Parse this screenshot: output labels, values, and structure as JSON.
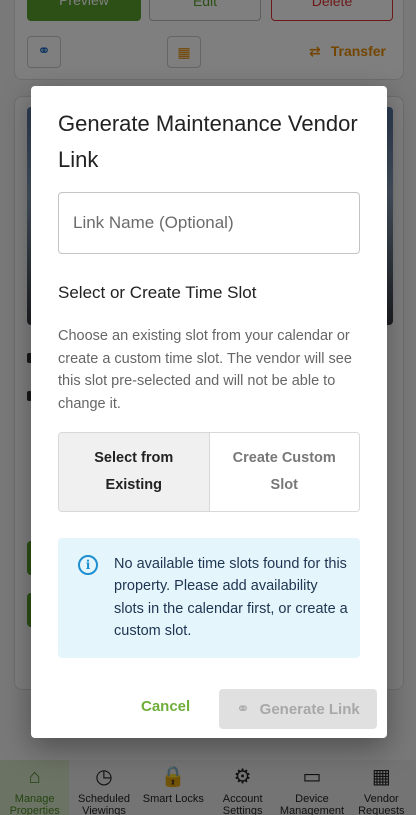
{
  "background": {
    "buttons": {
      "preview": "Preview",
      "edit": "Edit",
      "delete": "Delete",
      "transfer": "Transfer"
    }
  },
  "bottom_nav": [
    {
      "label": "Manage Properties",
      "icon": "home-icon",
      "glyph": "⌂",
      "active": true
    },
    {
      "label": "Scheduled Viewings",
      "icon": "clock-icon",
      "glyph": "◷",
      "active": false
    },
    {
      "label": "Smart Locks",
      "icon": "lock-icon",
      "glyph": "🔒",
      "active": false
    },
    {
      "label": "Account Settings",
      "icon": "gear-icon",
      "glyph": "⚙",
      "active": false
    },
    {
      "label": "Device Management",
      "icon": "devices-icon",
      "glyph": "▭",
      "active": false
    },
    {
      "label": "Vendor Requests",
      "icon": "building-icon",
      "glyph": "▦",
      "active": false
    }
  ],
  "dialog": {
    "title": "Generate Maintenance Vendor Link",
    "link_name_placeholder": "Link Name (Optional)",
    "section_title": "Select or Create Time Slot",
    "description": "Choose an existing slot from your calendar or create a custom time slot. The vendor will see this slot pre-selected and will not be able to change it.",
    "toggle": {
      "option_existing": "Select from Existing",
      "option_custom": "Create Custom Slot",
      "selected": "existing"
    },
    "info_message": "No available time slots found for this property. Please add availability slots in the calendar first, or create a custom slot.",
    "cancel_label": "Cancel",
    "generate_label": "Generate Link",
    "generate_disabled": true
  },
  "colors": {
    "accent_green": "#6fae3a",
    "info_blue": "#1e8fd0",
    "info_bg": "#e5f5fc",
    "delete_red": "#d33333",
    "transfer_orange": "#e68a00"
  }
}
